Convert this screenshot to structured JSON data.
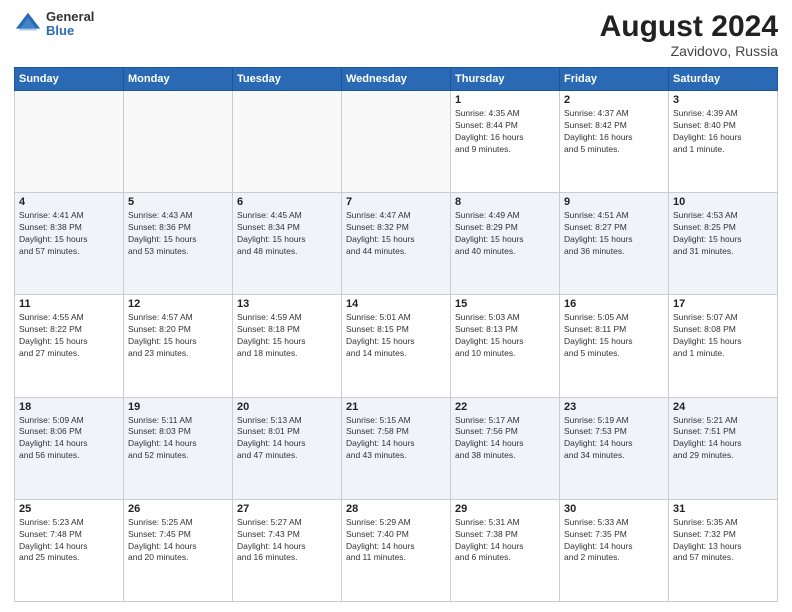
{
  "header": {
    "logo_general": "General",
    "logo_blue": "Blue",
    "month_year": "August 2024",
    "location": "Zavidovo, Russia"
  },
  "weekdays": [
    "Sunday",
    "Monday",
    "Tuesday",
    "Wednesday",
    "Thursday",
    "Friday",
    "Saturday"
  ],
  "weeks": [
    [
      {
        "day": "",
        "info": ""
      },
      {
        "day": "",
        "info": ""
      },
      {
        "day": "",
        "info": ""
      },
      {
        "day": "",
        "info": ""
      },
      {
        "day": "1",
        "info": "Sunrise: 4:35 AM\nSunset: 8:44 PM\nDaylight: 16 hours\nand 9 minutes."
      },
      {
        "day": "2",
        "info": "Sunrise: 4:37 AM\nSunset: 8:42 PM\nDaylight: 16 hours\nand 5 minutes."
      },
      {
        "day": "3",
        "info": "Sunrise: 4:39 AM\nSunset: 8:40 PM\nDaylight: 16 hours\nand 1 minute."
      }
    ],
    [
      {
        "day": "4",
        "info": "Sunrise: 4:41 AM\nSunset: 8:38 PM\nDaylight: 15 hours\nand 57 minutes."
      },
      {
        "day": "5",
        "info": "Sunrise: 4:43 AM\nSunset: 8:36 PM\nDaylight: 15 hours\nand 53 minutes."
      },
      {
        "day": "6",
        "info": "Sunrise: 4:45 AM\nSunset: 8:34 PM\nDaylight: 15 hours\nand 48 minutes."
      },
      {
        "day": "7",
        "info": "Sunrise: 4:47 AM\nSunset: 8:32 PM\nDaylight: 15 hours\nand 44 minutes."
      },
      {
        "day": "8",
        "info": "Sunrise: 4:49 AM\nSunset: 8:29 PM\nDaylight: 15 hours\nand 40 minutes."
      },
      {
        "day": "9",
        "info": "Sunrise: 4:51 AM\nSunset: 8:27 PM\nDaylight: 15 hours\nand 36 minutes."
      },
      {
        "day": "10",
        "info": "Sunrise: 4:53 AM\nSunset: 8:25 PM\nDaylight: 15 hours\nand 31 minutes."
      }
    ],
    [
      {
        "day": "11",
        "info": "Sunrise: 4:55 AM\nSunset: 8:22 PM\nDaylight: 15 hours\nand 27 minutes."
      },
      {
        "day": "12",
        "info": "Sunrise: 4:57 AM\nSunset: 8:20 PM\nDaylight: 15 hours\nand 23 minutes."
      },
      {
        "day": "13",
        "info": "Sunrise: 4:59 AM\nSunset: 8:18 PM\nDaylight: 15 hours\nand 18 minutes."
      },
      {
        "day": "14",
        "info": "Sunrise: 5:01 AM\nSunset: 8:15 PM\nDaylight: 15 hours\nand 14 minutes."
      },
      {
        "day": "15",
        "info": "Sunrise: 5:03 AM\nSunset: 8:13 PM\nDaylight: 15 hours\nand 10 minutes."
      },
      {
        "day": "16",
        "info": "Sunrise: 5:05 AM\nSunset: 8:11 PM\nDaylight: 15 hours\nand 5 minutes."
      },
      {
        "day": "17",
        "info": "Sunrise: 5:07 AM\nSunset: 8:08 PM\nDaylight: 15 hours\nand 1 minute."
      }
    ],
    [
      {
        "day": "18",
        "info": "Sunrise: 5:09 AM\nSunset: 8:06 PM\nDaylight: 14 hours\nand 56 minutes."
      },
      {
        "day": "19",
        "info": "Sunrise: 5:11 AM\nSunset: 8:03 PM\nDaylight: 14 hours\nand 52 minutes."
      },
      {
        "day": "20",
        "info": "Sunrise: 5:13 AM\nSunset: 8:01 PM\nDaylight: 14 hours\nand 47 minutes."
      },
      {
        "day": "21",
        "info": "Sunrise: 5:15 AM\nSunset: 7:58 PM\nDaylight: 14 hours\nand 43 minutes."
      },
      {
        "day": "22",
        "info": "Sunrise: 5:17 AM\nSunset: 7:56 PM\nDaylight: 14 hours\nand 38 minutes."
      },
      {
        "day": "23",
        "info": "Sunrise: 5:19 AM\nSunset: 7:53 PM\nDaylight: 14 hours\nand 34 minutes."
      },
      {
        "day": "24",
        "info": "Sunrise: 5:21 AM\nSunset: 7:51 PM\nDaylight: 14 hours\nand 29 minutes."
      }
    ],
    [
      {
        "day": "25",
        "info": "Sunrise: 5:23 AM\nSunset: 7:48 PM\nDaylight: 14 hours\nand 25 minutes."
      },
      {
        "day": "26",
        "info": "Sunrise: 5:25 AM\nSunset: 7:45 PM\nDaylight: 14 hours\nand 20 minutes."
      },
      {
        "day": "27",
        "info": "Sunrise: 5:27 AM\nSunset: 7:43 PM\nDaylight: 14 hours\nand 16 minutes."
      },
      {
        "day": "28",
        "info": "Sunrise: 5:29 AM\nSunset: 7:40 PM\nDaylight: 14 hours\nand 11 minutes."
      },
      {
        "day": "29",
        "info": "Sunrise: 5:31 AM\nSunset: 7:38 PM\nDaylight: 14 hours\nand 6 minutes."
      },
      {
        "day": "30",
        "info": "Sunrise: 5:33 AM\nSunset: 7:35 PM\nDaylight: 14 hours\nand 2 minutes."
      },
      {
        "day": "31",
        "info": "Sunrise: 5:35 AM\nSunset: 7:32 PM\nDaylight: 13 hours\nand 57 minutes."
      }
    ]
  ]
}
